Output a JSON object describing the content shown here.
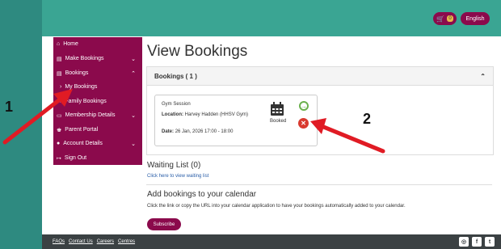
{
  "header": {
    "cart_count": "0",
    "language": "English"
  },
  "sidebar": {
    "items": [
      {
        "label": "Home",
        "icon": "home-icon"
      },
      {
        "label": "Make Bookings",
        "icon": "calendar-icon",
        "chevron": "⌄"
      },
      {
        "label": "Bookings",
        "icon": "calendar-icon",
        "chevron": "⌃"
      },
      {
        "label": "My Bookings",
        "icon": "chevron-right-icon"
      },
      {
        "label": "Family Bookings",
        "icon": "chevron-right-icon"
      },
      {
        "label": "Membership Details",
        "icon": "id-card-icon",
        "chevron": "⌄"
      },
      {
        "label": "Parent Portal",
        "icon": "trophy-icon"
      },
      {
        "label": "Account Details",
        "icon": "user-icon",
        "chevron": "⌄"
      },
      {
        "label": "Sign Out",
        "icon": "sign-out-icon"
      }
    ]
  },
  "main": {
    "title": "View Bookings",
    "panel_title": "Bookings ( 1 )",
    "booking": {
      "title": "Gym Session",
      "location_label": "Location:",
      "location_value": "Harvey Hadden (HHSV Gym)",
      "date_label": "Date:",
      "date_value": "26 Jan, 2026 17:00 - 18:00",
      "status": "Booked"
    },
    "waiting_title": "Waiting List (0)",
    "waiting_link": "Click here to view waiting list",
    "calendar_title": "Add bookings to your calendar",
    "calendar_desc": "Click the link or copy the URL into your calendar application to have your bookings automatically added to your calendar.",
    "subscribe_label": "Subscribe"
  },
  "footer": {
    "links": [
      "FAQs",
      "Contact Us",
      "Careers",
      "Centres"
    ]
  },
  "annotations": {
    "one": "1",
    "two": "2"
  },
  "colors": {
    "brand": "#8b0a4c",
    "teal": "#3aa593",
    "arrow": "#e01b24"
  }
}
